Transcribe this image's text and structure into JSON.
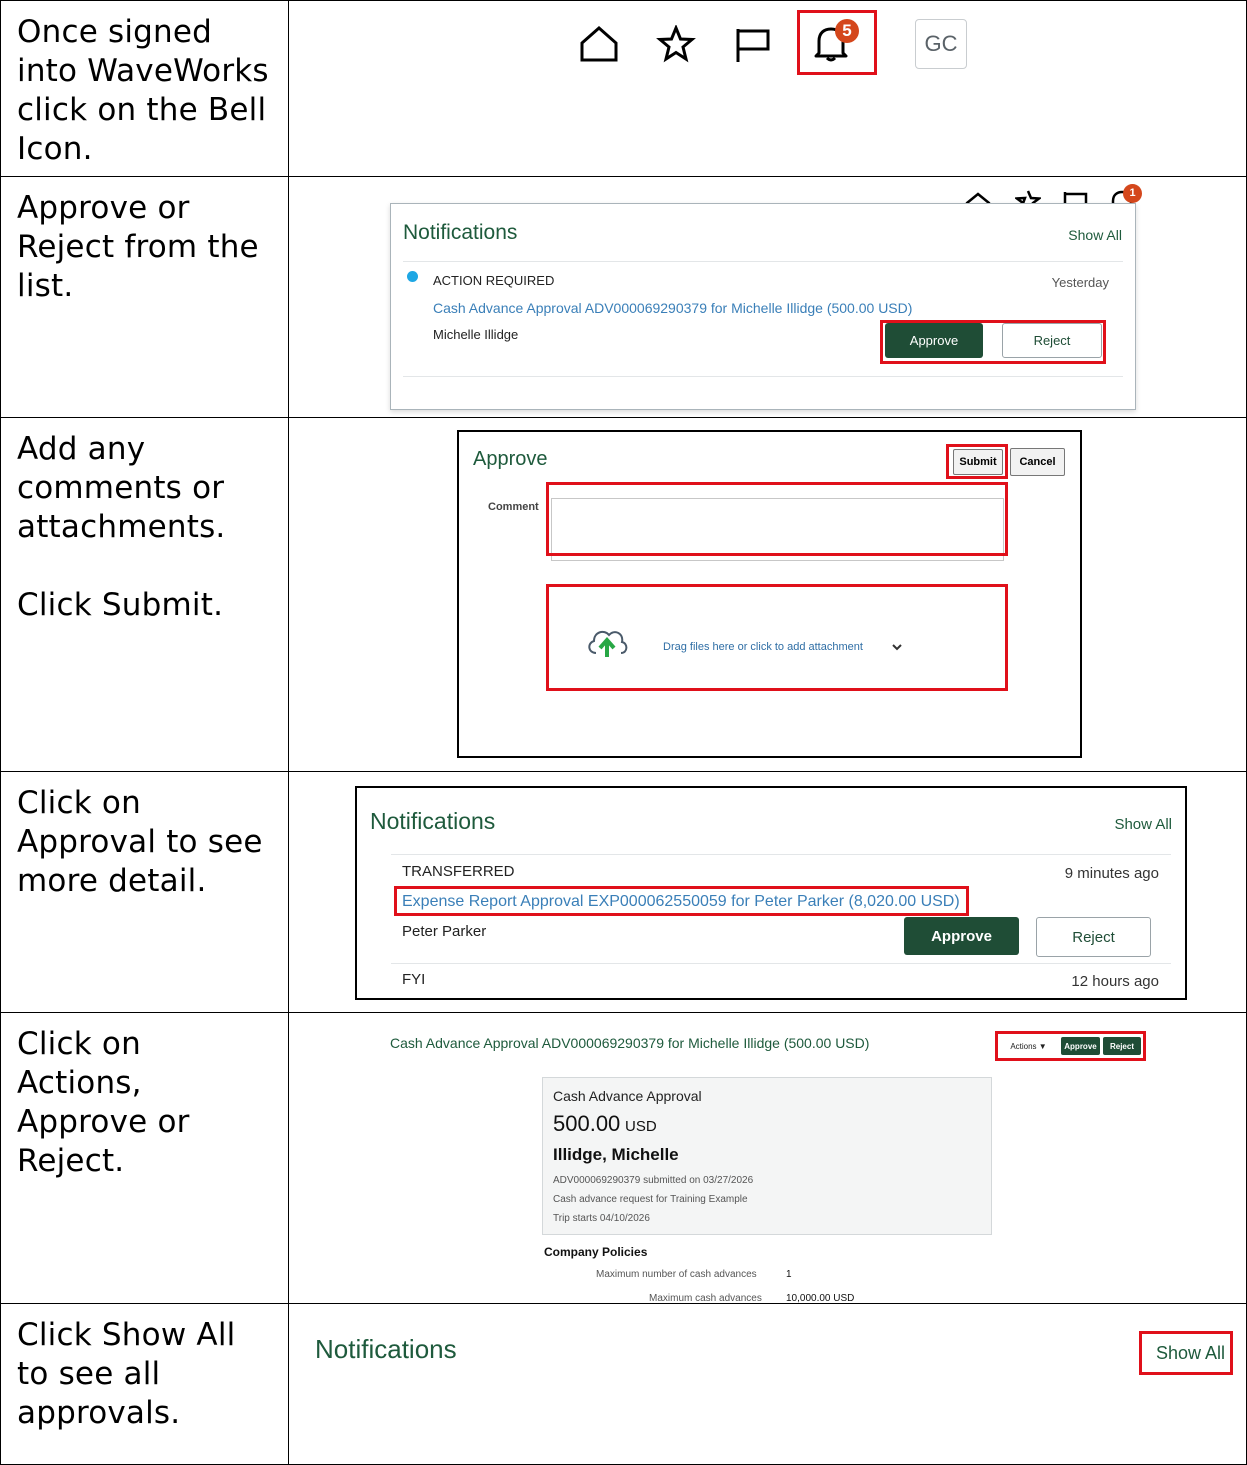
{
  "steps": [
    {
      "instruction": "Once signed\ninto WaveWorks\nclick on the Bell\nIcon."
    },
    {
      "instruction": "Approve or\nReject from the\nlist."
    },
    {
      "instruction": "Add any\ncomments or\nattachments.\n\nClick Submit."
    },
    {
      "instruction": "Click on\nApproval to see\nmore detail."
    },
    {
      "instruction": "Click on\nActions,\nApprove or\nReject."
    },
    {
      "instruction": "Click Show All\nto see all\napprovals."
    }
  ],
  "toolbar": {
    "bell_badge": "5",
    "avatar_initials": "GC",
    "icons": [
      "home-icon",
      "star-icon",
      "flag-icon",
      "bell-icon"
    ]
  },
  "notif1": {
    "small_badge": "1",
    "title": "Notifications",
    "show_all": "Show All",
    "status": "ACTION REQUIRED",
    "time": "Yesterday",
    "link": "Cash Advance Approval ADV000069290379 for Michelle Illidge (500.00 USD)",
    "person": "Michelle Illidge",
    "approve": "Approve",
    "reject": "Reject"
  },
  "approve_dialog": {
    "title": "Approve",
    "submit": "Submit",
    "cancel": "Cancel",
    "comment_label": "Comment",
    "comment_value": "",
    "drop_text": "Drag files here or click to add attachment"
  },
  "notif2": {
    "title": "Notifications",
    "show_all": "Show All",
    "status": "TRANSFERRED",
    "time": "9 minutes ago",
    "link": "Expense Report Approval EXP000062550059 for Peter Parker (8,020.00 USD)",
    "person": "Peter Parker",
    "approve": "Approve",
    "reject": "Reject",
    "status2": "FYI",
    "time2": "12 hours ago"
  },
  "detail": {
    "header": "Cash Advance Approval ADV000069290379 for Michelle Illidge (500.00 USD)",
    "actions": "Actions ▼",
    "approve": "Approve",
    "reject": "Reject",
    "card_title": "Cash Advance Approval",
    "amount": "500.00",
    "currency": "USD",
    "name": "Illidge, Michelle",
    "line1": "ADV000069290379 submitted on 03/27/2026",
    "line2": "Cash advance request for Training Example",
    "line3": "Trip starts 04/10/2026",
    "policies_title": "Company Policies",
    "policy1_label": "Maximum number of cash advances",
    "policy1_value": "1",
    "policy2_label": "Maximum cash advances",
    "policy2_value": "10,000.00 USD"
  },
  "notif3": {
    "title": "Notifications",
    "show_all": "Show All"
  },
  "colors": {
    "highlight": "#e0101a",
    "brand_green": "#1f4d36",
    "link_blue": "#3a7fb8",
    "badge_orange": "#d4471c"
  }
}
